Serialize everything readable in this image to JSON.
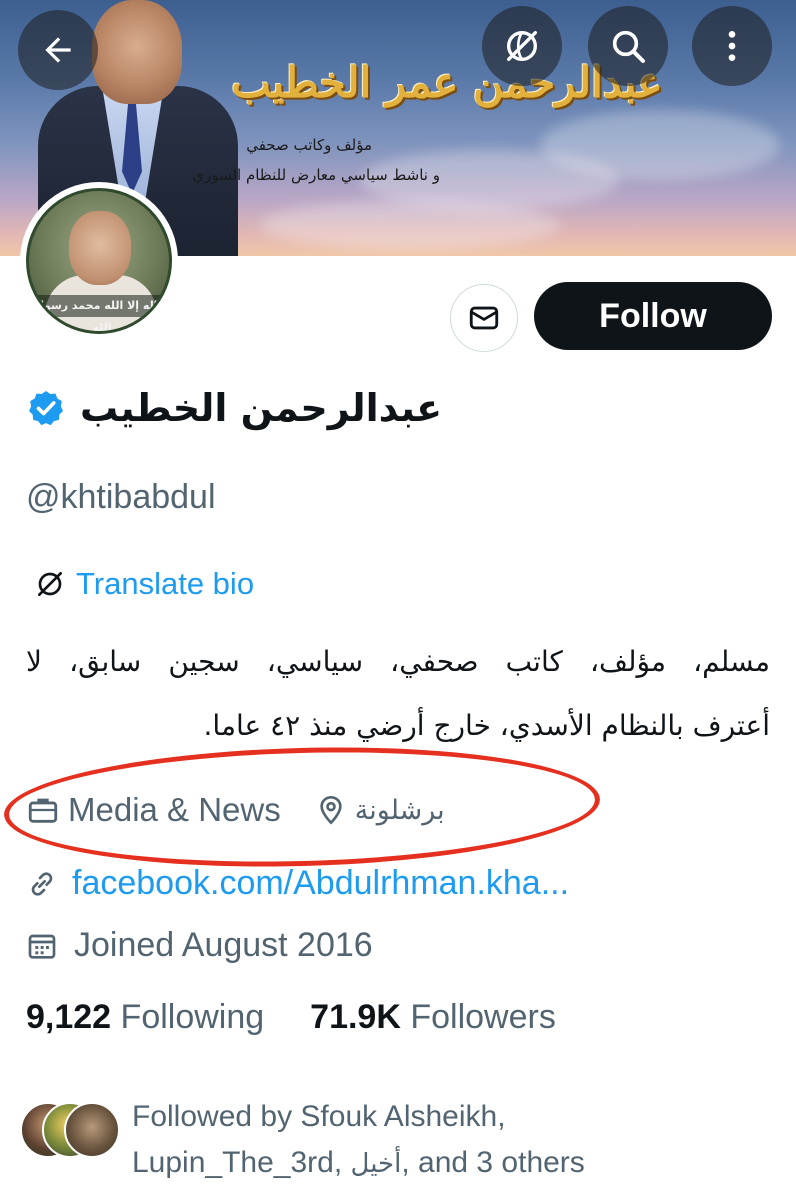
{
  "banner": {
    "title": "عبدالرحمن عمر الخطيب",
    "line1": "مؤلف وكاتب صحفي",
    "line2": "و ناشط سياسي معارض للنظام السوري"
  },
  "header_icons": {
    "back": "arrow-left-icon",
    "translate": "translate-icon",
    "search": "search-icon",
    "more": "more-vertical-icon"
  },
  "avatar": {
    "overlay_text": "لا إله إلا الله محمد رسول الله"
  },
  "actions": {
    "message_icon": "envelope-icon",
    "follow_label": "Follow"
  },
  "profile": {
    "display_name": "عبدالرحمن الخطيب",
    "verified_icon": "verified-badge-icon",
    "handle": "@khtibabdul",
    "translate_label": "Translate bio",
    "bio_line1": "مسلم، مؤلف، كاتب صحفي، سياسي، سجين سابق، لا",
    "bio_line2": "أعترف بالنظام الأسدي، خارج أرضي منذ ٤٢ عاما.",
    "category": "Media & News",
    "location": "برشلونة",
    "link": "facebook.com/Abdulrhman.kha...",
    "joined": "Joined August 2016"
  },
  "stats": {
    "following_count": "9,122",
    "following_label": "Following",
    "followers_count": "71.9K",
    "followers_label": "Followers"
  },
  "followed_by": {
    "prefix": "Followed by Sfouk Alsheikh,",
    "line2_a": "Lupin_The_3rd, ",
    "line2_ar": "أخيل",
    "line2_b": ", and 3 others"
  },
  "colors": {
    "accent": "#1d9bf0",
    "text_primary": "#0f1419",
    "text_secondary": "#536471",
    "annotation": "#e5301f",
    "follow_button": "#0f1419"
  }
}
